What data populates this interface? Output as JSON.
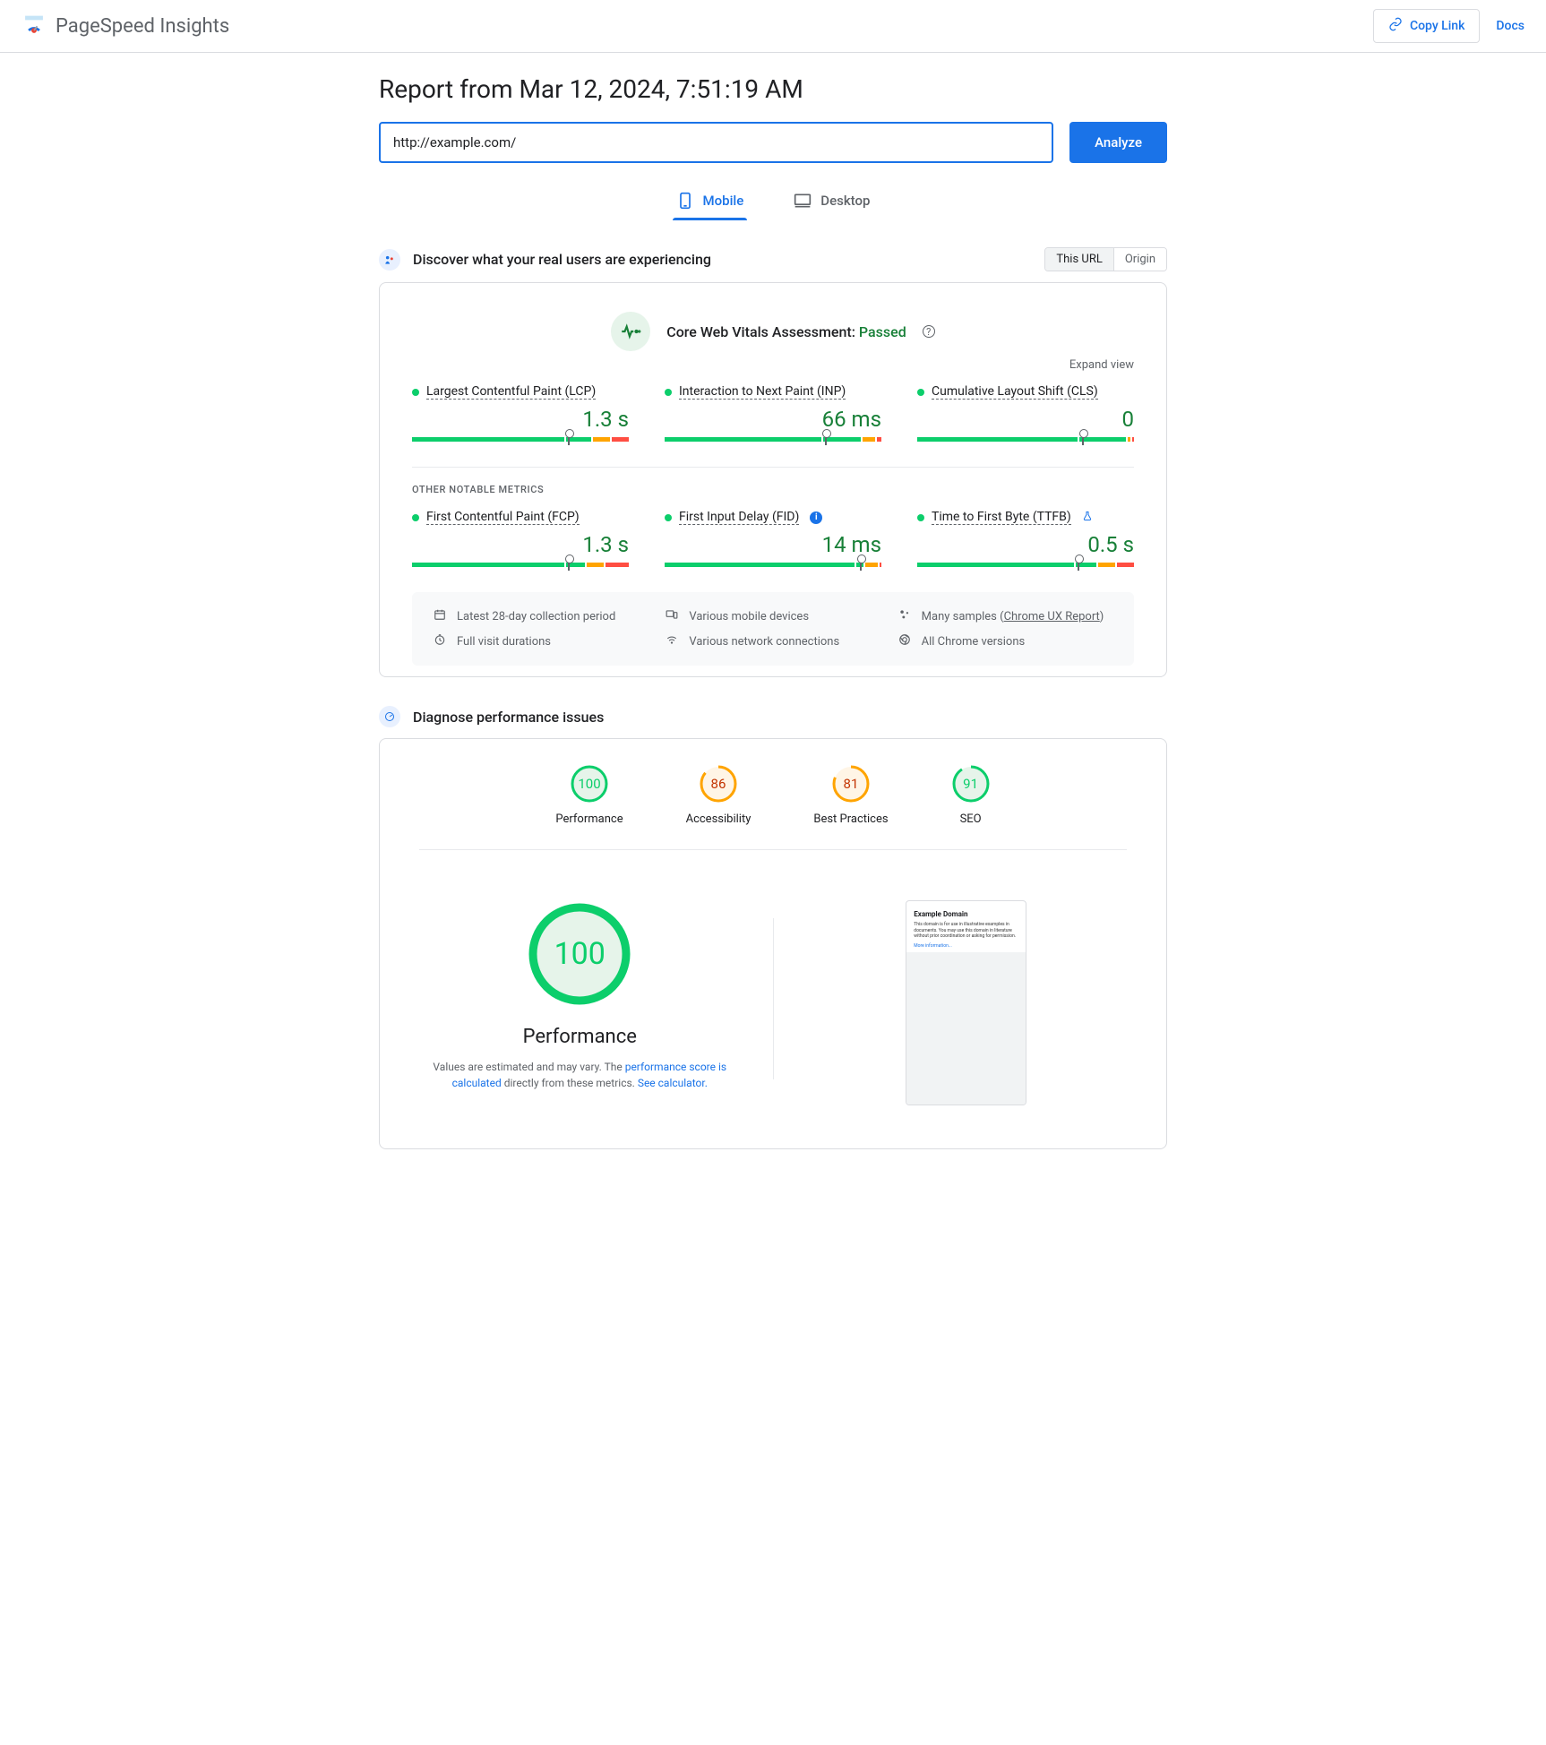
{
  "header": {
    "logo_text": "PageSpeed Insights",
    "copy_link_label": "Copy Link",
    "docs_label": "Docs"
  },
  "report_title": "Report from Mar 12, 2024, 7:51:19 AM",
  "url_input_value": "http://example.com/",
  "analyze_label": "Analyze",
  "tabs": {
    "mobile": "Mobile",
    "desktop": "Desktop"
  },
  "discover": {
    "title": "Discover what your real users are experiencing",
    "toggle_url": "This URL",
    "toggle_origin": "Origin"
  },
  "cwv": {
    "title_prefix": "Core Web Vitals Assessment: ",
    "status": "Passed",
    "expand": "Expand view"
  },
  "vitals": [
    {
      "name": "Largest Contentful Paint (LCP)",
      "value": "1.3 s",
      "marker": 72,
      "g": 72,
      "lg": 12,
      "o": 8,
      "r": 8
    },
    {
      "name": "Interaction to Next Paint (INP)",
      "value": "66 ms",
      "marker": 74,
      "g": 74,
      "lg": 18,
      "o": 6,
      "r": 2
    },
    {
      "name": "Cumulative Layout Shift (CLS)",
      "value": "0",
      "marker": 76,
      "g": 76,
      "lg": 22,
      "o": 1,
      "r": 1
    }
  ],
  "other_label": "OTHER NOTABLE METRICS",
  "other_metrics": [
    {
      "name": "First Contentful Paint (FCP)",
      "value": "1.3 s",
      "badge": "",
      "marker": 72,
      "g": 72,
      "lg": 9,
      "o": 8,
      "r": 11
    },
    {
      "name": "First Input Delay (FID)",
      "value": "14 ms",
      "badge": "info",
      "marker": 90,
      "g": 90,
      "lg": 3,
      "o": 6,
      "r": 1
    },
    {
      "name": "Time to First Byte (TTFB)",
      "value": "0.5 s",
      "badge": "flask",
      "marker": 74,
      "g": 74,
      "lg": 10,
      "o": 8,
      "r": 8
    }
  ],
  "footer": {
    "period": "Latest 28-day collection period",
    "devices": "Various mobile devices",
    "samples_prefix": "Many samples (",
    "samples_link": "Chrome UX Report",
    "samples_suffix": ")",
    "durations": "Full visit durations",
    "connections": "Various network connections",
    "versions": "All Chrome versions"
  },
  "diagnose": {
    "title": "Diagnose performance issues"
  },
  "gauges": [
    {
      "score": 100,
      "label": "Performance",
      "color": "green"
    },
    {
      "score": 86,
      "label": "Accessibility",
      "color": "orange"
    },
    {
      "score": 81,
      "label": "Best Practices",
      "color": "orange"
    },
    {
      "score": 91,
      "label": "SEO",
      "color": "green"
    }
  ],
  "big_gauge": {
    "score": 100,
    "label": "Performance",
    "desc_1": "Values are estimated and may vary. The ",
    "link_1": "performance score is calculated",
    "desc_2": " directly from these metrics. ",
    "link_2": "See calculator."
  },
  "preview": {
    "title": "Example Domain",
    "text": "This domain is for use in illustrative examples in documents. You may use this domain in literature without prior coordination or asking for permission.",
    "more": "More information..."
  },
  "colors": {
    "green": "#0cce6b",
    "orange": "#ffa400",
    "red": "#ff4e42"
  }
}
